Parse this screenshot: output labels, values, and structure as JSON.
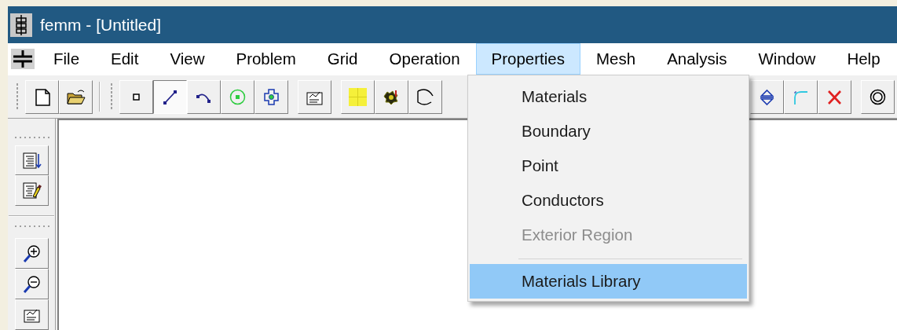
{
  "window": {
    "title": "femm - [Untitled]"
  },
  "menu_bar": [
    {
      "label": "File",
      "selected": false
    },
    {
      "label": "Edit",
      "selected": false
    },
    {
      "label": "View",
      "selected": false
    },
    {
      "label": "Problem",
      "selected": false
    },
    {
      "label": "Grid",
      "selected": false
    },
    {
      "label": "Operation",
      "selected": false
    },
    {
      "label": "Properties",
      "selected": true
    },
    {
      "label": "Mesh",
      "selected": false
    },
    {
      "label": "Analysis",
      "selected": false
    },
    {
      "label": "Window",
      "selected": false
    },
    {
      "label": "Help",
      "selected": false
    }
  ],
  "draw_tools": [
    {
      "pressed": false
    },
    {
      "pressed": true
    },
    {
      "pressed": false
    },
    {
      "pressed": false
    },
    {
      "pressed": false
    }
  ],
  "dropdown": {
    "items": [
      {
        "kind": "item",
        "label": "Materials",
        "disabled": false,
        "selected": false
      },
      {
        "kind": "item",
        "label": "Boundary",
        "disabled": false,
        "selected": false
      },
      {
        "kind": "item",
        "label": "Point",
        "disabled": false,
        "selected": false
      },
      {
        "kind": "item",
        "label": "Conductors",
        "disabled": false,
        "selected": false
      },
      {
        "kind": "item",
        "label": "Exterior Region",
        "disabled": true,
        "selected": false
      },
      {
        "kind": "separator"
      },
      {
        "kind": "item",
        "label": "Materials Library",
        "disabled": false,
        "selected": true
      }
    ]
  }
}
